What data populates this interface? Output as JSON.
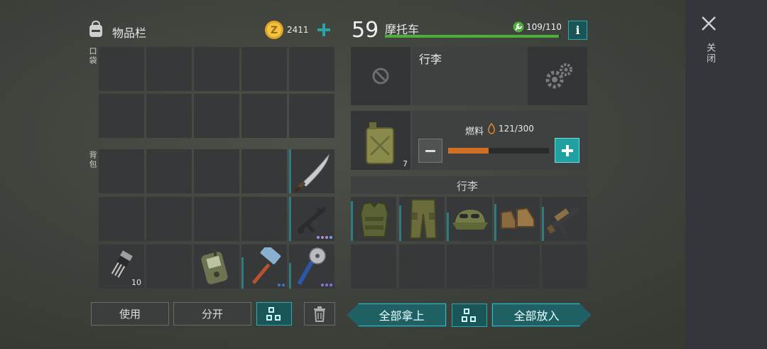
{
  "inventory": {
    "title": "物品栏",
    "coins": "2411",
    "pocket_label": "口袋",
    "backpack_label": "背包",
    "items": {
      "transistor_count": "10"
    }
  },
  "vehicle": {
    "level": "59",
    "name": "摩托车",
    "durability": "109/110",
    "info_label": "i",
    "luggage_label": "行李",
    "fuel_label": "燃料",
    "fuel_value": "121/300",
    "fuel_fraction": 0.4,
    "canister_count": "7",
    "cargo_title": "行李",
    "health_fraction": 0.99
  },
  "buttons": {
    "use": "使用",
    "split": "分开",
    "take_all": "全部拿上",
    "put_all": "全部放入"
  },
  "close_label": "关闭",
  "colors": {
    "teal": "#2aa3a6",
    "green_bar": "#4caf3a",
    "fuel_orange": "#d07020",
    "coin_gold": "#e0a526"
  }
}
